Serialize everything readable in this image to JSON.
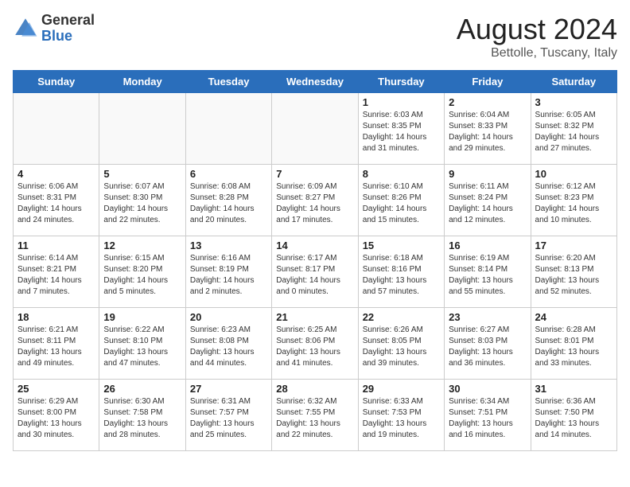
{
  "header": {
    "logo_general": "General",
    "logo_blue": "Blue",
    "month_title": "August 2024",
    "location": "Bettolle, Tuscany, Italy"
  },
  "days_of_week": [
    "Sunday",
    "Monday",
    "Tuesday",
    "Wednesday",
    "Thursday",
    "Friday",
    "Saturday"
  ],
  "weeks": [
    [
      {
        "day": "",
        "info": ""
      },
      {
        "day": "",
        "info": ""
      },
      {
        "day": "",
        "info": ""
      },
      {
        "day": "",
        "info": ""
      },
      {
        "day": "1",
        "info": "Sunrise: 6:03 AM\nSunset: 8:35 PM\nDaylight: 14 hours\nand 31 minutes."
      },
      {
        "day": "2",
        "info": "Sunrise: 6:04 AM\nSunset: 8:33 PM\nDaylight: 14 hours\nand 29 minutes."
      },
      {
        "day": "3",
        "info": "Sunrise: 6:05 AM\nSunset: 8:32 PM\nDaylight: 14 hours\nand 27 minutes."
      }
    ],
    [
      {
        "day": "4",
        "info": "Sunrise: 6:06 AM\nSunset: 8:31 PM\nDaylight: 14 hours\nand 24 minutes."
      },
      {
        "day": "5",
        "info": "Sunrise: 6:07 AM\nSunset: 8:30 PM\nDaylight: 14 hours\nand 22 minutes."
      },
      {
        "day": "6",
        "info": "Sunrise: 6:08 AM\nSunset: 8:28 PM\nDaylight: 14 hours\nand 20 minutes."
      },
      {
        "day": "7",
        "info": "Sunrise: 6:09 AM\nSunset: 8:27 PM\nDaylight: 14 hours\nand 17 minutes."
      },
      {
        "day": "8",
        "info": "Sunrise: 6:10 AM\nSunset: 8:26 PM\nDaylight: 14 hours\nand 15 minutes."
      },
      {
        "day": "9",
        "info": "Sunrise: 6:11 AM\nSunset: 8:24 PM\nDaylight: 14 hours\nand 12 minutes."
      },
      {
        "day": "10",
        "info": "Sunrise: 6:12 AM\nSunset: 8:23 PM\nDaylight: 14 hours\nand 10 minutes."
      }
    ],
    [
      {
        "day": "11",
        "info": "Sunrise: 6:14 AM\nSunset: 8:21 PM\nDaylight: 14 hours\nand 7 minutes."
      },
      {
        "day": "12",
        "info": "Sunrise: 6:15 AM\nSunset: 8:20 PM\nDaylight: 14 hours\nand 5 minutes."
      },
      {
        "day": "13",
        "info": "Sunrise: 6:16 AM\nSunset: 8:19 PM\nDaylight: 14 hours\nand 2 minutes."
      },
      {
        "day": "14",
        "info": "Sunrise: 6:17 AM\nSunset: 8:17 PM\nDaylight: 14 hours\nand 0 minutes."
      },
      {
        "day": "15",
        "info": "Sunrise: 6:18 AM\nSunset: 8:16 PM\nDaylight: 13 hours\nand 57 minutes."
      },
      {
        "day": "16",
        "info": "Sunrise: 6:19 AM\nSunset: 8:14 PM\nDaylight: 13 hours\nand 55 minutes."
      },
      {
        "day": "17",
        "info": "Sunrise: 6:20 AM\nSunset: 8:13 PM\nDaylight: 13 hours\nand 52 minutes."
      }
    ],
    [
      {
        "day": "18",
        "info": "Sunrise: 6:21 AM\nSunset: 8:11 PM\nDaylight: 13 hours\nand 49 minutes."
      },
      {
        "day": "19",
        "info": "Sunrise: 6:22 AM\nSunset: 8:10 PM\nDaylight: 13 hours\nand 47 minutes."
      },
      {
        "day": "20",
        "info": "Sunrise: 6:23 AM\nSunset: 8:08 PM\nDaylight: 13 hours\nand 44 minutes."
      },
      {
        "day": "21",
        "info": "Sunrise: 6:25 AM\nSunset: 8:06 PM\nDaylight: 13 hours\nand 41 minutes."
      },
      {
        "day": "22",
        "info": "Sunrise: 6:26 AM\nSunset: 8:05 PM\nDaylight: 13 hours\nand 39 minutes."
      },
      {
        "day": "23",
        "info": "Sunrise: 6:27 AM\nSunset: 8:03 PM\nDaylight: 13 hours\nand 36 minutes."
      },
      {
        "day": "24",
        "info": "Sunrise: 6:28 AM\nSunset: 8:01 PM\nDaylight: 13 hours\nand 33 minutes."
      }
    ],
    [
      {
        "day": "25",
        "info": "Sunrise: 6:29 AM\nSunset: 8:00 PM\nDaylight: 13 hours\nand 30 minutes."
      },
      {
        "day": "26",
        "info": "Sunrise: 6:30 AM\nSunset: 7:58 PM\nDaylight: 13 hours\nand 28 minutes."
      },
      {
        "day": "27",
        "info": "Sunrise: 6:31 AM\nSunset: 7:57 PM\nDaylight: 13 hours\nand 25 minutes."
      },
      {
        "day": "28",
        "info": "Sunrise: 6:32 AM\nSunset: 7:55 PM\nDaylight: 13 hours\nand 22 minutes."
      },
      {
        "day": "29",
        "info": "Sunrise: 6:33 AM\nSunset: 7:53 PM\nDaylight: 13 hours\nand 19 minutes."
      },
      {
        "day": "30",
        "info": "Sunrise: 6:34 AM\nSunset: 7:51 PM\nDaylight: 13 hours\nand 16 minutes."
      },
      {
        "day": "31",
        "info": "Sunrise: 6:36 AM\nSunset: 7:50 PM\nDaylight: 13 hours\nand 14 minutes."
      }
    ]
  ]
}
